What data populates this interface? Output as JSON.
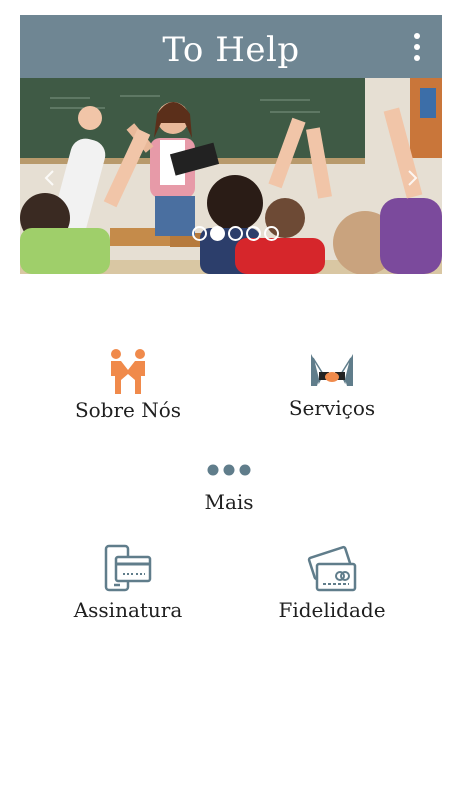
{
  "app_bar": {
    "title": "To Help",
    "menu_icon": "more-vertical-icon",
    "background_color": "#6f8693"
  },
  "carousel": {
    "slide_count": 5,
    "active_slide": 2,
    "prev_icon": "chevron-left-icon",
    "next_icon": "chevron-right-icon"
  },
  "menu": {
    "about": {
      "label": "Sobre Nós",
      "icon": "handshake-people-icon"
    },
    "services": {
      "label": "Serviços",
      "icon": "business-handshake-icon"
    },
    "more": {
      "label": "Mais",
      "icon": "more-horizontal-icon"
    },
    "subscription": {
      "label": "Assinatura",
      "icon": "phone-card-icon"
    },
    "loyalty": {
      "label": "Fidelidade",
      "icon": "card-cash-icon"
    }
  },
  "colors": {
    "accent_orange": "#f08a4b",
    "icon_gray": "#607d8b",
    "text": "#1f1f1f"
  }
}
